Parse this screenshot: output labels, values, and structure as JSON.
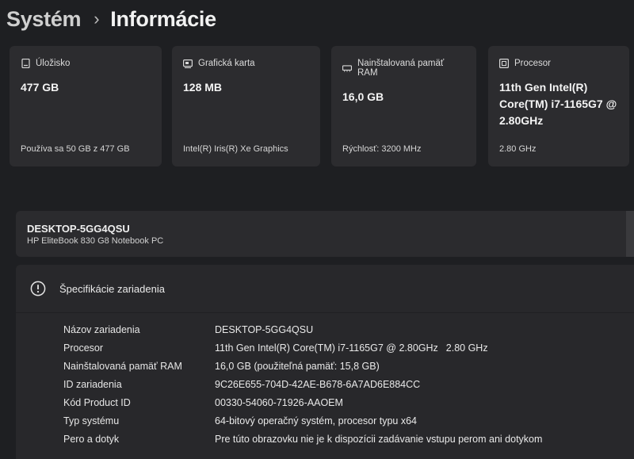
{
  "breadcrumb": {
    "parent": "Systém",
    "separator": "›",
    "current": "Informácie"
  },
  "cards": [
    {
      "icon": "storage-icon",
      "title": "Úložisko",
      "value": "477 GB",
      "sub": "Používa sa 50 GB z 477 GB"
    },
    {
      "icon": "graphics-card-icon",
      "title": "Grafická karta",
      "value": "128 MB",
      "sub": "Intel(R) Iris(R) Xe Graphics"
    },
    {
      "icon": "ram-icon",
      "title": "Nainštalovaná pamäť RAM",
      "value": "16,0 GB",
      "sub": "Rýchlosť: 3200 MHz"
    },
    {
      "icon": "processor-icon",
      "title": "Procesor",
      "value": "11th Gen Intel(R) Core(TM) i7-1165G7 @ 2.80GHz",
      "sub": "2.80 GHz"
    }
  ],
  "device": {
    "name": "DESKTOP-5GG4QSU",
    "model": "HP EliteBook 830 G8 Notebook PC"
  },
  "specs": {
    "title": "Špecifikácie zariadenia",
    "icon": "info-icon",
    "rows": [
      {
        "key": "Názov zariadenia",
        "value": "DESKTOP-5GG4QSU"
      },
      {
        "key": "Procesor",
        "value": "11th Gen Intel(R) Core(TM) i7-1165G7 @ 2.80GHz",
        "extra": "2.80 GHz"
      },
      {
        "key": "Nainštalovaná pamäť RAM",
        "value": "16,0 GB (použiteľná pamäť: 15,8 GB)"
      },
      {
        "key": "ID zariadenia",
        "value": "9C26E655-704D-42AE-B678-6A7AD6E884CC"
      },
      {
        "key": "Kód Product ID",
        "value": "00330-54060-71926-AAOEM"
      },
      {
        "key": "Typ systému",
        "value": "64-bitový operačný systém, procesor typu x64"
      },
      {
        "key": "Pero a dotyk",
        "value": "Pre túto obrazovku nie je k dispozícii zadávanie vstupu perom ani dotykom"
      }
    ]
  }
}
